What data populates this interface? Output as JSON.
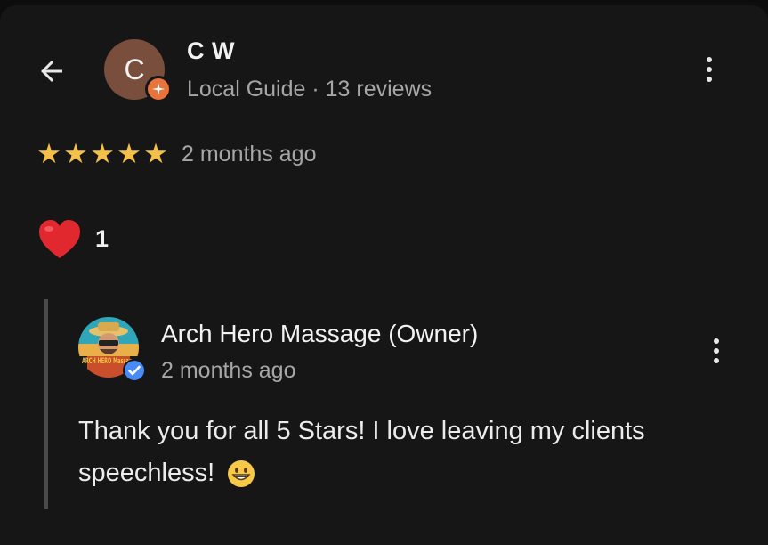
{
  "review": {
    "author_initial": "C",
    "author_name": "C W",
    "author_meta": "Local Guide · 13 reviews",
    "rating": 5,
    "rating_max": 5,
    "time": "2 months ago",
    "likes": "1"
  },
  "reply": {
    "owner_name": "Arch Hero Massage (Owner)",
    "time": "2 months ago",
    "text": "Thank you for all 5 Stars! I love leaving my clients speechless!",
    "avatar_text": "ARCH HERO Massage"
  },
  "icons": {
    "back": "arrow-left-icon",
    "menu": "more-vert-icon",
    "star": "star-icon",
    "heart": "heart-icon",
    "guide": "local-guide-icon",
    "verified": "verified-icon",
    "emoji": "grinning-face-icon"
  },
  "colors": {
    "background": "#161616",
    "star": "#f5c04a",
    "guide_badge": "#e8743b",
    "verified": "#4a8af4",
    "heart": "#e0282e",
    "secondary_text": "#a6a6a6"
  }
}
